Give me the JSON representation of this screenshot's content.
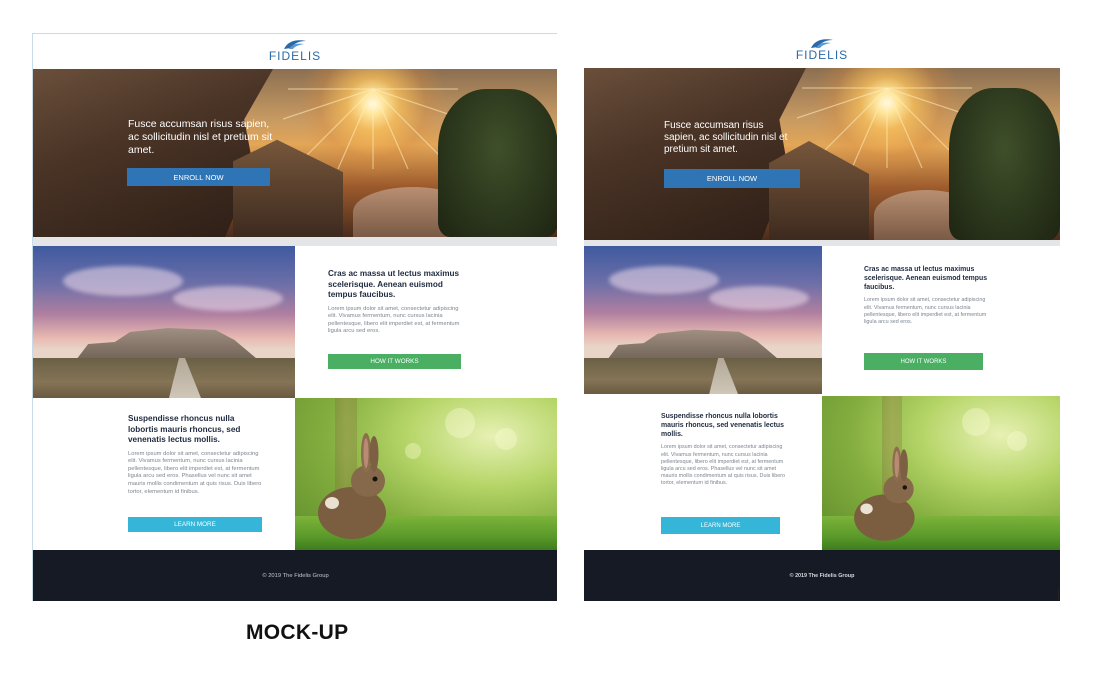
{
  "caption": "MOCK-UP",
  "brand": {
    "logo_text": "FIDELIS",
    "primary": "#2f74b5",
    "green": "#4aae63",
    "cyan": "#35b5d8",
    "footer_bg": "#151a24"
  },
  "mockup": {
    "hero": {
      "text": "Fusce accumsan risus sapien, ac sollicitudin nisl et pretium sit amet.",
      "cta": "ENROLL NOW"
    },
    "section_1": {
      "heading": "Cras ac massa ut lectus maximus scelerisque. Aenean euismod tempus faucibus.",
      "body": "Lorem ipsum dolor sit amet, consectetur adipiscing elit. Vivamus fermentum, nunc cursus lacinia pellentesque, libero elit imperdiet est, at fermentum ligula arcu sed eros.",
      "cta": "HOW IT WORKS"
    },
    "section_2": {
      "heading": "Suspendisse rhoncus nulla lobortis mauris rhoncus, sed venenatis lectus mollis.",
      "body": "Lorem ipsum dolor sit amet, consectetur adipiscing elit. Vivamus fermentum, nunc cursus lacinia pellentesque, libero elit imperdiet est, at fermentum ligula arcu sed eros. Phasellus vel nunc sit amet mauris mollis condimentum at quis risus. Duis libero tortor, elementum id finibus.",
      "cta": "LEARN MORE"
    },
    "footer": "© 2019 The Fidelis Group"
  },
  "built": {
    "hero": {
      "text": "Fusce accumsan risus sapien, ac sollicitudin nisl et pretium sit amet.",
      "cta": "ENROLL NOW"
    },
    "section_1": {
      "heading": "Cras ac massa ut lectus maximus scelerisque. Aenean euismod tempus faucibus.",
      "body": "Lorem ipsum dolor sit amet, consectetur adipiscing elit. Vivamus fermentum, nunc cursus lacinia pellentesque, libero elit imperdiet est, at fermentum ligula arcu sed eros.",
      "cta": "HOW IT WORKS"
    },
    "section_2": {
      "heading": "Suspendisse rhoncus nulla lobortis mauris rhoncus, sed venenatis lectus mollis.",
      "body": "Lorem ipsum dolor sit amet, consectetur adipiscing elit. Vivamus fermentum, nunc cursus lacinia pellentesque, libero elit imperdiet est, at fermentum ligula arcu sed eros. Phasellus vel nunc sit amet mauris mollis condimentum at quis risus. Duis libero tortor, elementum id finibus.",
      "cta": "LEARN MORE"
    },
    "footer": "© 2019 The Fidelis Group"
  },
  "icons": {
    "logo": "fidelis-bird-logo"
  }
}
